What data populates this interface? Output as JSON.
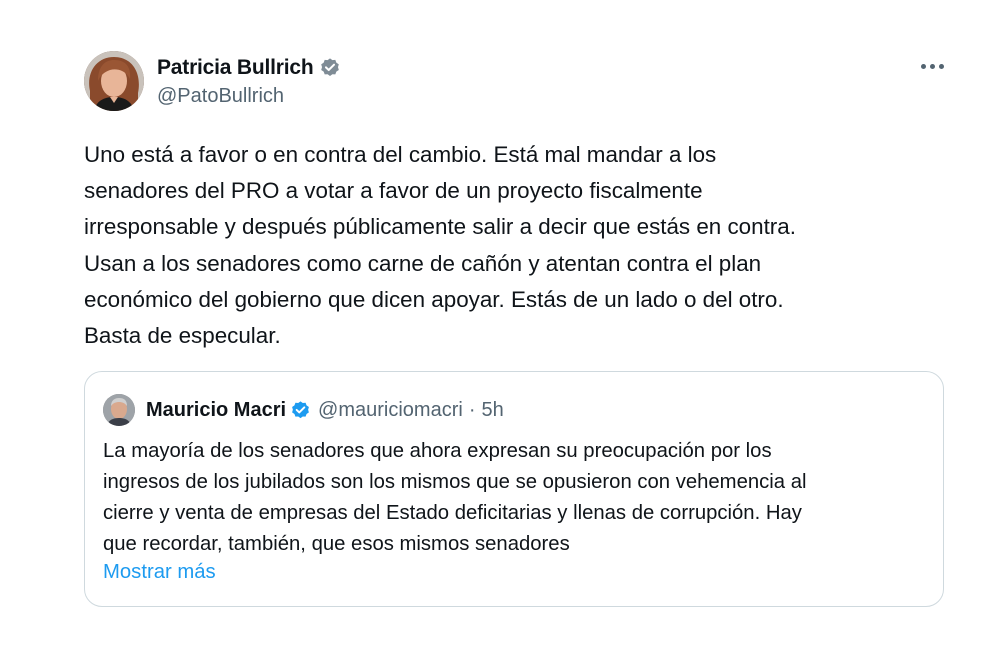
{
  "tweet": {
    "author": {
      "name": "Patricia Bullrich",
      "handle": "@PatoBullrich",
      "verified": true
    },
    "more_icon": "ellipsis-icon",
    "text_lines": [
      "Uno está a favor o en contra del cambio. Está mal mandar a los",
      "senadores del PRO a votar a favor de un proyecto fiscalmente",
      "irresponsable y después públicamente salir a decir que estás en contra.",
      "Usan a los senadores como carne de cañón y atentan contra el plan",
      "económico del gobierno que dicen apoyar. Estás de un lado o del otro.",
      "Basta de especular."
    ],
    "quoted": {
      "author": {
        "name": "Mauricio Macri",
        "handle": "@mauriciomacri",
        "verified": true
      },
      "separator": "·",
      "time": "5h",
      "text_lines": [
        "La mayoría de los senadores que ahora expresan su preocupación por los",
        "ingresos de los jubilados son los mismos que se opusieron con vehemencia al",
        "cierre y venta de empresas del Estado deficitarias y llenas de corrupción. Hay",
        "que recordar, también, que esos mismos senadores"
      ],
      "show_more": "Mostrar más"
    }
  },
  "colors": {
    "text_primary": "#0f1419",
    "text_secondary": "#536471",
    "link": "#1d9bf0",
    "verified_badge": "#1d9bf0",
    "border": "#cfd9de"
  }
}
